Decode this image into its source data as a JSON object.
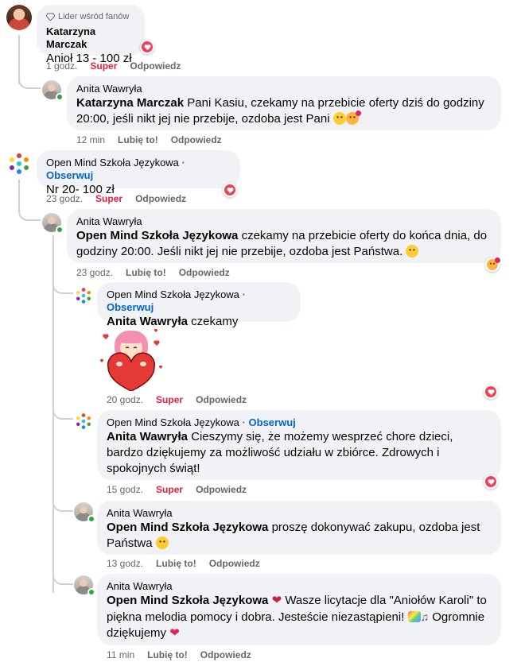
{
  "comments": [
    {
      "badge": "Lider wśród fanów",
      "author": "Katarzyna Marczak",
      "text": "Anioł 13 - 100 zł",
      "time": "1 godz.",
      "reaction_label": "Super",
      "reply_label": "Odpowiedz"
    },
    {
      "author": "Anita Wawryła",
      "mention": "Katarzyna Marczak",
      "text": "Pani Kasiu, czekamy na przebicie oferty dziś do godziny 20:00, jeśli nikt jej nie przebije, ozdoba jest Pani",
      "time": "12 min",
      "like_label": "Lubię to!",
      "reply_label": "Odpowiedz"
    },
    {
      "author": "Open Mind Szkoła Językowa",
      "follow_label": "Obserwuj",
      "text": "Nr 20- 100 zł",
      "time": "23 godz.",
      "reaction_label": "Super",
      "reply_label": "Odpowiedz"
    },
    {
      "author": "Anita Wawryła",
      "mention": "Open Mind Szkoła Językowa",
      "text": "czekamy na przebicie oferty do końca dnia, do godziny 20:00. Jeśli nikt jej nie przebije, ozdoba jest Państwa.",
      "time": "23 godz.",
      "like_label": "Lubię to!",
      "reply_label": "Odpowiedz"
    },
    {
      "author": "Open Mind Szkoła Językowa",
      "follow_label": "Obserwuj",
      "mention": "Anita Wawryła",
      "text": "czekamy",
      "time": "20 godz.",
      "reaction_label": "Super",
      "reply_label": "Odpowiedz"
    },
    {
      "author": "Open Mind Szkoła Językowa",
      "follow_label": "Obserwuj",
      "mention": "Anita Wawryła",
      "text": "Cieszymy się, że możemy wesprzeć chore dzieci, bardzo dziękujemy za możliwość udziału w zbiórce. Zdrowych i spokojnych świąt!",
      "time": "15 godz.",
      "reaction_label": "Super",
      "reply_label": "Odpowiedz"
    },
    {
      "author": "Anita Wawryła",
      "mention": "Open Mind Szkoła Językowa",
      "text": "proszę dokonywać zakupu, ozdoba jest Państwa",
      "time": "13 godz.",
      "like_label": "Lubię to!",
      "reply_label": "Odpowiedz"
    },
    {
      "author": "Anita Wawryła",
      "mention": "Open Mind Szkoła Językowa",
      "text_1": "Wasze licytacje dla \"Aniołów Karoli\" to piękna melodia pomocy i dobra. Jesteście niezastąpieni!",
      "text_2": "Ogromnie dziękujemy",
      "time": "11 min",
      "like_label": "Lubię to!",
      "reply_label": "Odpowiedz"
    }
  ],
  "colors": {
    "super": "#e41e3f",
    "follow": "#0064d1",
    "bubble": "#f0f2f5",
    "muted": "#65676b"
  }
}
